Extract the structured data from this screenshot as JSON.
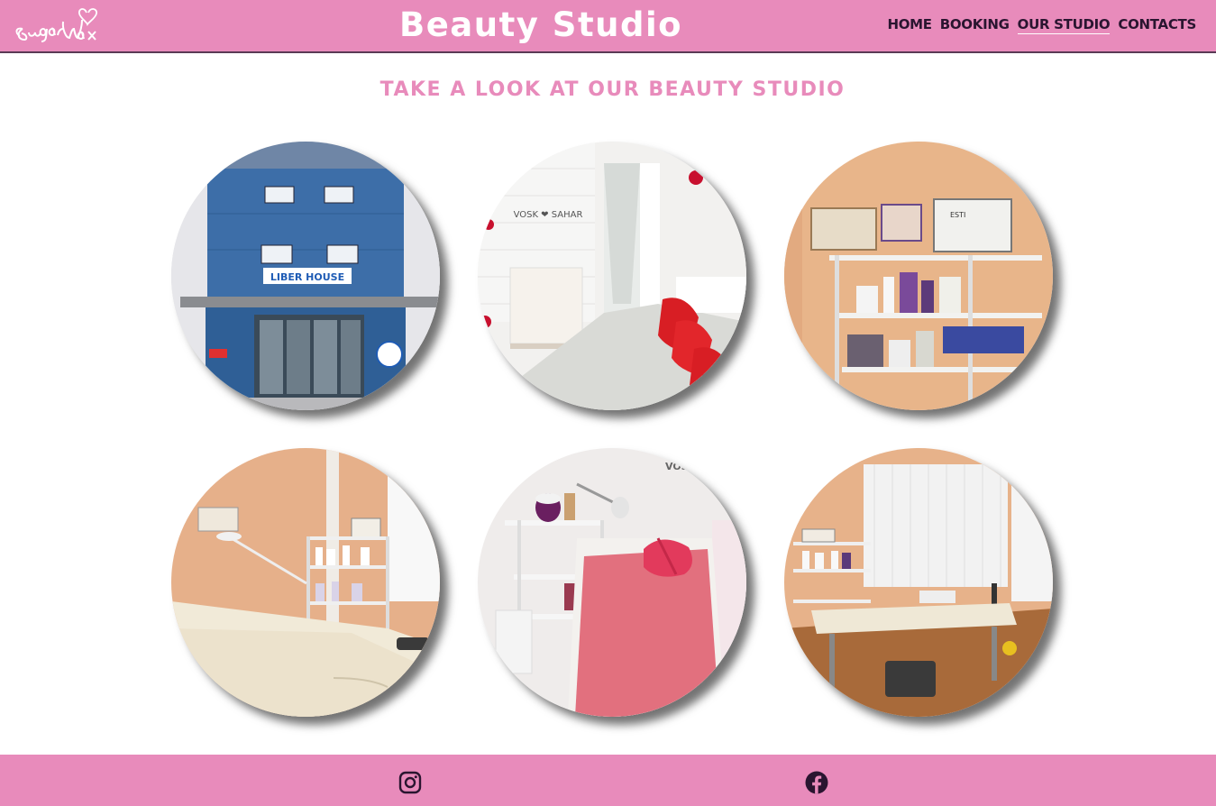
{
  "header": {
    "logo_text": "Sugar Wax",
    "title": "Beauty Studio",
    "nav": [
      {
        "label": "HOME",
        "active": false
      },
      {
        "label": "BOOKING",
        "active": false
      },
      {
        "label": "OUR STUDIO",
        "active": true
      },
      {
        "label": "CONTACTS",
        "active": false
      }
    ]
  },
  "main": {
    "heading": "TAKE A LOOK AT OUR BEAUTY STUDIO",
    "photos": [
      {
        "subject": "building-exterior",
        "sign_text": "LIBER HOUSE"
      },
      {
        "subject": "reception-corridor",
        "sign_text": "VOSK ❤ SAHAR"
      },
      {
        "subject": "supply-shelves",
        "sign_text": "ESTI"
      },
      {
        "subject": "treatment-room-couch",
        "sign_text": ""
      },
      {
        "subject": "wax-station-pink-couch",
        "sign_text": "VOSK"
      },
      {
        "subject": "treatment-room-window",
        "sign_text": ""
      }
    ]
  },
  "footer": {
    "icons": [
      "instagram-icon",
      "facebook-icon"
    ]
  },
  "colors": {
    "brand_pink": "#e88bbb",
    "nav_text": "#2a1530",
    "header_border": "#5a3a55",
    "background": "#ffffff"
  }
}
